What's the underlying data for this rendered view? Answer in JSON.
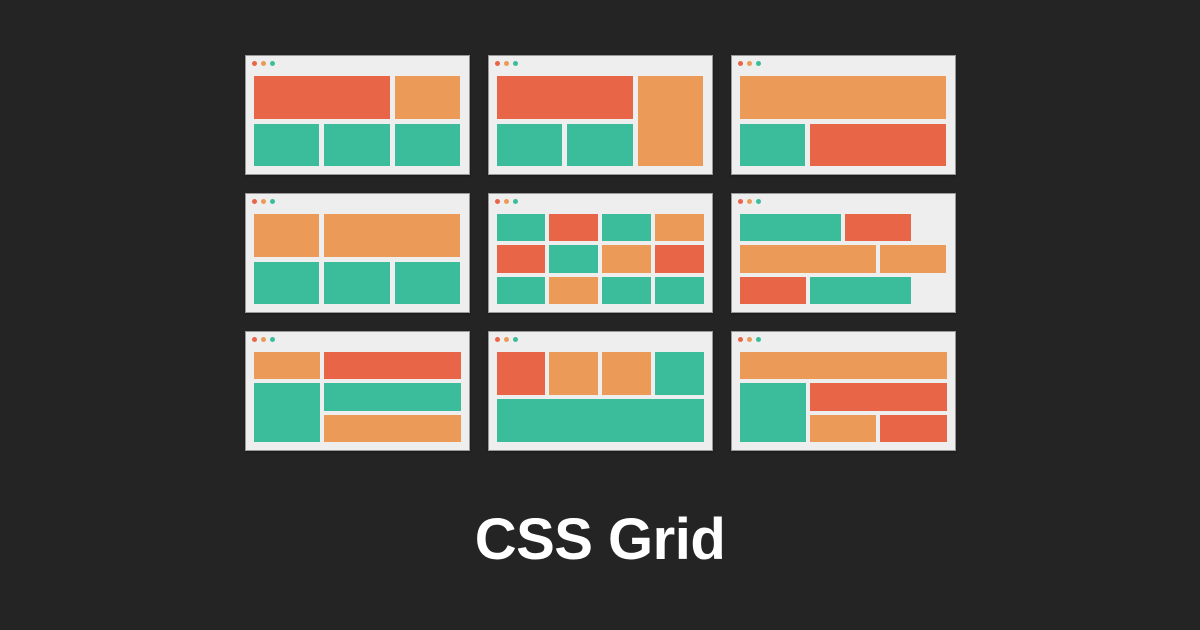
{
  "title": "CSS Grid",
  "colors": {
    "red": "#e86548",
    "orange": "#eb9b57",
    "green": "#3bbd9b",
    "window_bg": "#eeeeee",
    "page_bg": "#252424"
  },
  "windows": [
    {
      "id": "w1",
      "rows": 2,
      "cols": 3,
      "cells": [
        "red",
        "orange",
        "green",
        "green",
        "green"
      ]
    },
    {
      "id": "w2",
      "rows": 2,
      "cols": 3,
      "cells": [
        "red",
        "orange",
        "green",
        "green"
      ]
    },
    {
      "id": "w3",
      "rows": 2,
      "cols": 3,
      "cells": [
        "orange",
        "green",
        "red"
      ]
    },
    {
      "id": "w4",
      "rows": 2,
      "cols": 3,
      "cells": [
        "orange",
        "orange",
        "green",
        "green",
        "green"
      ]
    },
    {
      "id": "w5",
      "rows": 3,
      "cols": 4,
      "cells": [
        "green",
        "red",
        "green",
        "orange",
        "red",
        "green",
        "orange",
        "red",
        "green",
        "orange",
        "green",
        "green"
      ]
    },
    {
      "id": "w6",
      "rows": 3,
      "cols": 6,
      "cells": [
        "green",
        "red",
        "orange",
        "orange",
        "red",
        "green"
      ]
    },
    {
      "id": "w7",
      "rows": 3,
      "cols": 3,
      "cells": [
        "orange",
        "red",
        "green",
        "green",
        "orange"
      ]
    },
    {
      "id": "w8",
      "rows": 2,
      "cols": 4,
      "cells": [
        "red",
        "orange",
        "orange",
        "green",
        "green"
      ]
    },
    {
      "id": "w9",
      "rows": 3,
      "cols": 3,
      "cells": [
        "orange",
        "green",
        "red",
        "orange",
        "red"
      ]
    }
  ]
}
